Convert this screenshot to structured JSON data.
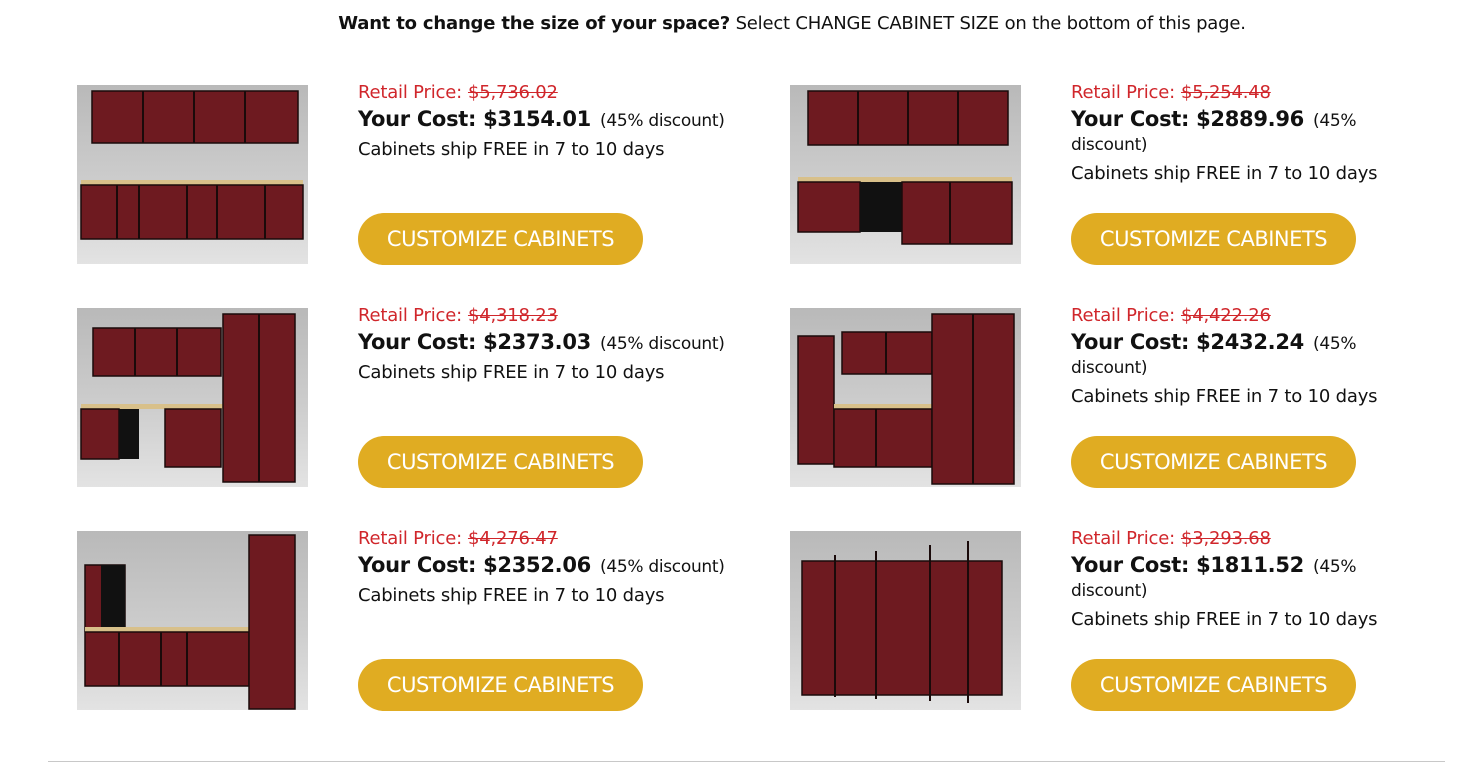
{
  "intro": {
    "bold": "Want to change the size of your space?",
    "rest": " Select CHANGE CABINET SIZE on the bottom of this page."
  },
  "products": [
    {
      "retail_label": "Retail Price:",
      "retail_price": "$5,736.02",
      "cost_label": "Your Cost:",
      "cost": "$3154.01",
      "discount": "(45% discount)",
      "shipping": "Cabinets ship FREE in 7 to 10 days",
      "button": "CUSTOMIZE CABINETS"
    },
    {
      "retail_label": "Retail Price:",
      "retail_price": "$5,254.48",
      "cost_label": "Your Cost:",
      "cost": "$2889.96",
      "discount": "(45% discount)",
      "shipping": "Cabinets ship FREE in 7 to 10 days",
      "button": "CUSTOMIZE CABINETS"
    },
    {
      "retail_label": "Retail Price:",
      "retail_price": "$4,318.23",
      "cost_label": "Your Cost:",
      "cost": "$2373.03",
      "discount": "(45% discount)",
      "shipping": "Cabinets ship FREE in 7 to 10 days",
      "button": "CUSTOMIZE CABINETS"
    },
    {
      "retail_label": "Retail Price:",
      "retail_price": "$4,422.26",
      "cost_label": "Your Cost:",
      "cost": "$2432.24",
      "discount": "(45% discount)",
      "shipping": "Cabinets ship FREE in 7 to 10 days",
      "button": "CUSTOMIZE CABINETS"
    },
    {
      "retail_label": "Retail Price:",
      "retail_price": "$4,276.47",
      "cost_label": "Your Cost:",
      "cost": "$2352.06",
      "discount": "(45% discount)",
      "shipping": "Cabinets ship FREE in 7 to 10 days",
      "button": "CUSTOMIZE CABINETS"
    },
    {
      "retail_label": "Retail Price:",
      "retail_price": "$3,293.68",
      "cost_label": "Your Cost:",
      "cost": "$1811.52",
      "discount": "(45% discount)",
      "shipping": "Cabinets ship FREE in 7 to 10 days",
      "button": "CUSTOMIZE CABINETS"
    }
  ],
  "colors": {
    "button": "#e0ac22",
    "retail": "#d0262b",
    "cabinet": "#6e1a20"
  }
}
